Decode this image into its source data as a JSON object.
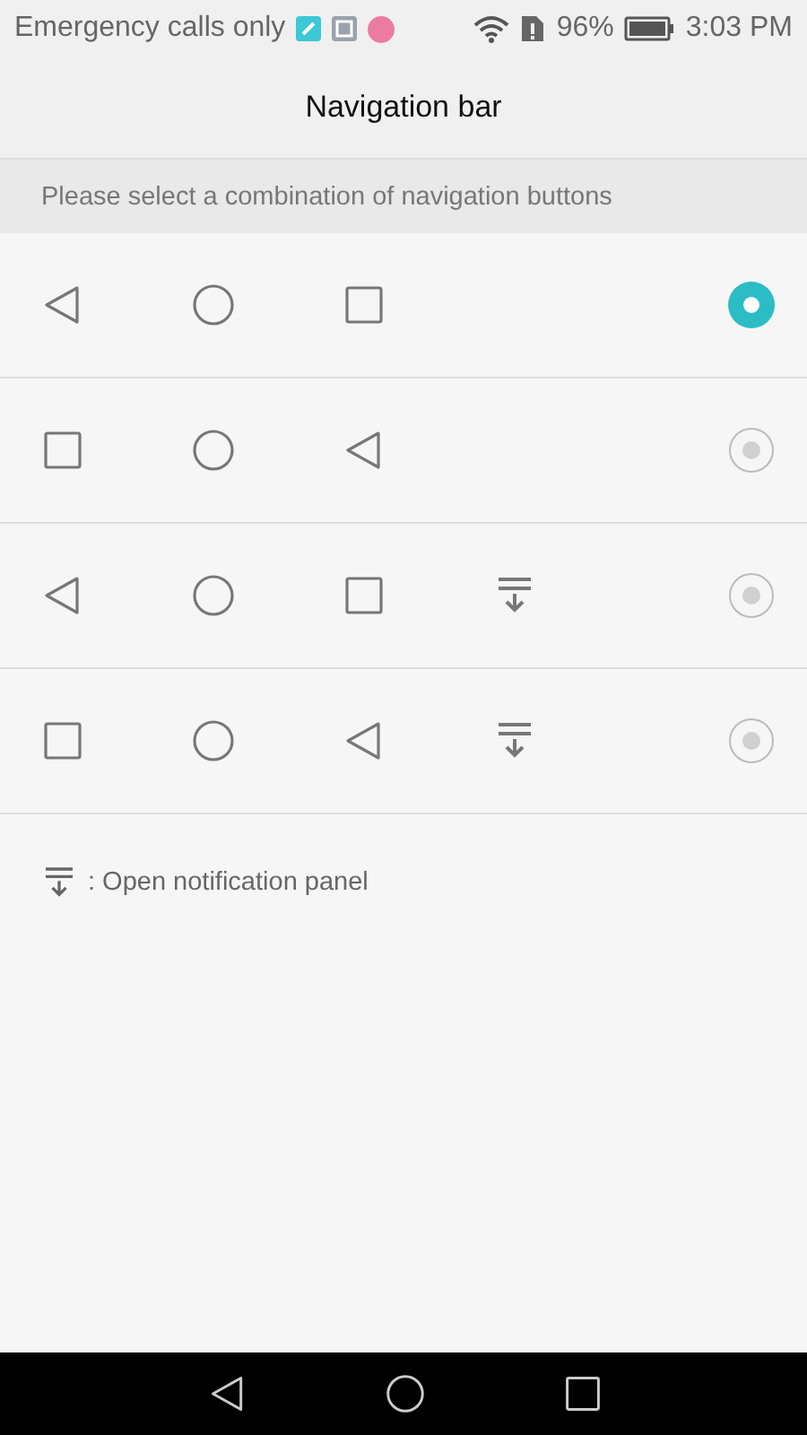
{
  "status_bar": {
    "carrier": "Emergency calls only",
    "battery": "96%",
    "time": "3:03 PM"
  },
  "title": "Navigation bar",
  "subheader": "Please select a combination of navigation buttons",
  "options": [
    {
      "selected": true,
      "buttons": [
        {
          "kind": "back"
        },
        {
          "kind": "home"
        },
        {
          "kind": "recent"
        }
      ]
    },
    {
      "selected": false,
      "buttons": [
        {
          "kind": "recent"
        },
        {
          "kind": "home"
        },
        {
          "kind": "back"
        }
      ]
    },
    {
      "selected": false,
      "buttons": [
        {
          "kind": "back"
        },
        {
          "kind": "home"
        },
        {
          "kind": "recent"
        },
        {
          "kind": "notification"
        }
      ]
    },
    {
      "selected": false,
      "buttons": [
        {
          "kind": "recent"
        },
        {
          "kind": "home"
        },
        {
          "kind": "back"
        },
        {
          "kind": "notification"
        }
      ]
    }
  ],
  "legend": {
    "kind": "notification",
    "text": ": Open notification panel"
  },
  "nav_bar": [
    {
      "kind": "back"
    },
    {
      "kind": "home"
    },
    {
      "kind": "recent"
    }
  ]
}
